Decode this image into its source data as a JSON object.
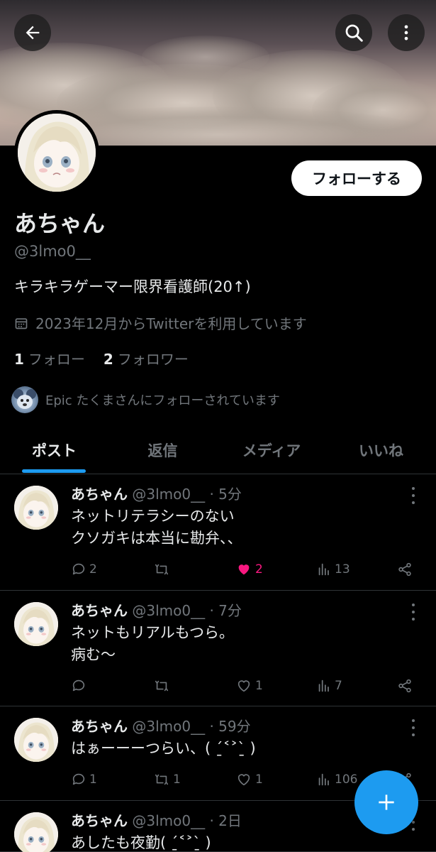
{
  "header": {
    "back_icon": "arrow-left-icon",
    "search_icon": "search-icon",
    "more_icon": "more-vertical-icon"
  },
  "profile": {
    "follow_label": "フォローする",
    "name": "あちゃん",
    "handle": "@3lmo0__",
    "bio": "キラキラゲーマー限界看護師(20↑)",
    "joined": "2023年12月からTwitterを利用しています",
    "following_count": "1",
    "following_label": "フォロー",
    "followers_count": "2",
    "followers_label": "フォロワー",
    "followed_by": "Epic たくまさんにフォローされています"
  },
  "tabs": [
    {
      "label": "ポスト",
      "active": true
    },
    {
      "label": "返信",
      "active": false
    },
    {
      "label": "メディア",
      "active": false
    },
    {
      "label": "いいね",
      "active": false
    }
  ],
  "posts": [
    {
      "name": "あちゃん",
      "meta": "@3lmo0__ · 5分",
      "text": "ネットリテラシーのない\nクソガキは本当に勘弁、、",
      "replies": "2",
      "reposts": "",
      "likes": "2",
      "liked": true,
      "views": "13"
    },
    {
      "name": "あちゃん",
      "meta": "@3lmo0__ · 7分",
      "text": "ネットもリアルもつら。\n病む〜",
      "replies": "",
      "reposts": "",
      "likes": "1",
      "liked": false,
      "views": "7"
    },
    {
      "name": "あちゃん",
      "meta": "@3lmo0__ · 59分",
      "text": "はぁーーーつらい、( ˊ̱˂˃ˋ̱ )",
      "replies": "1",
      "reposts": "1",
      "likes": "1",
      "liked": false,
      "views": "106"
    },
    {
      "name": "あちゃん",
      "meta": "@3lmo0__ · 2日",
      "text": "あしたも夜勤( ˊ̱˂˃ˋ̱ )",
      "replies": "",
      "reposts": "",
      "likes": "",
      "liked": false,
      "views": ""
    }
  ],
  "fab_icon": "plus-icon",
  "colors": {
    "accent": "#1d9bf0",
    "like": "#f91880",
    "muted": "#71767b",
    "text": "#e7e9ea"
  }
}
